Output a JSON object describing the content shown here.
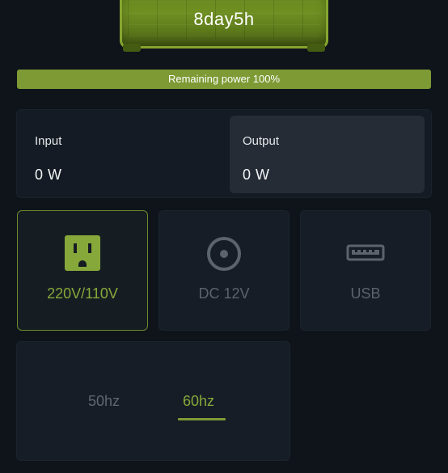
{
  "device": {
    "remaining_time": "8day5h"
  },
  "power": {
    "label": "Remaining power 100%",
    "level_percent": 100
  },
  "io": {
    "input_label": "Input",
    "input_value": "0 W",
    "output_label": "Output",
    "output_value": "0 W"
  },
  "modes": [
    {
      "label": "220V/110V",
      "icon": "ac-outlet-icon",
      "selected": true
    },
    {
      "label": "DC 12V",
      "icon": "dc-port-icon",
      "selected": false
    },
    {
      "label": "USB",
      "icon": "usb-port-icon",
      "selected": false
    }
  ],
  "frequency": {
    "options": [
      "50hz",
      "60hz"
    ],
    "selected": "60hz"
  },
  "colors": {
    "accent": "#7d9a34",
    "accent_text": "#86a83a",
    "background": "#0f141b",
    "card": "#161d26",
    "inactive_text": "#5b636d"
  }
}
